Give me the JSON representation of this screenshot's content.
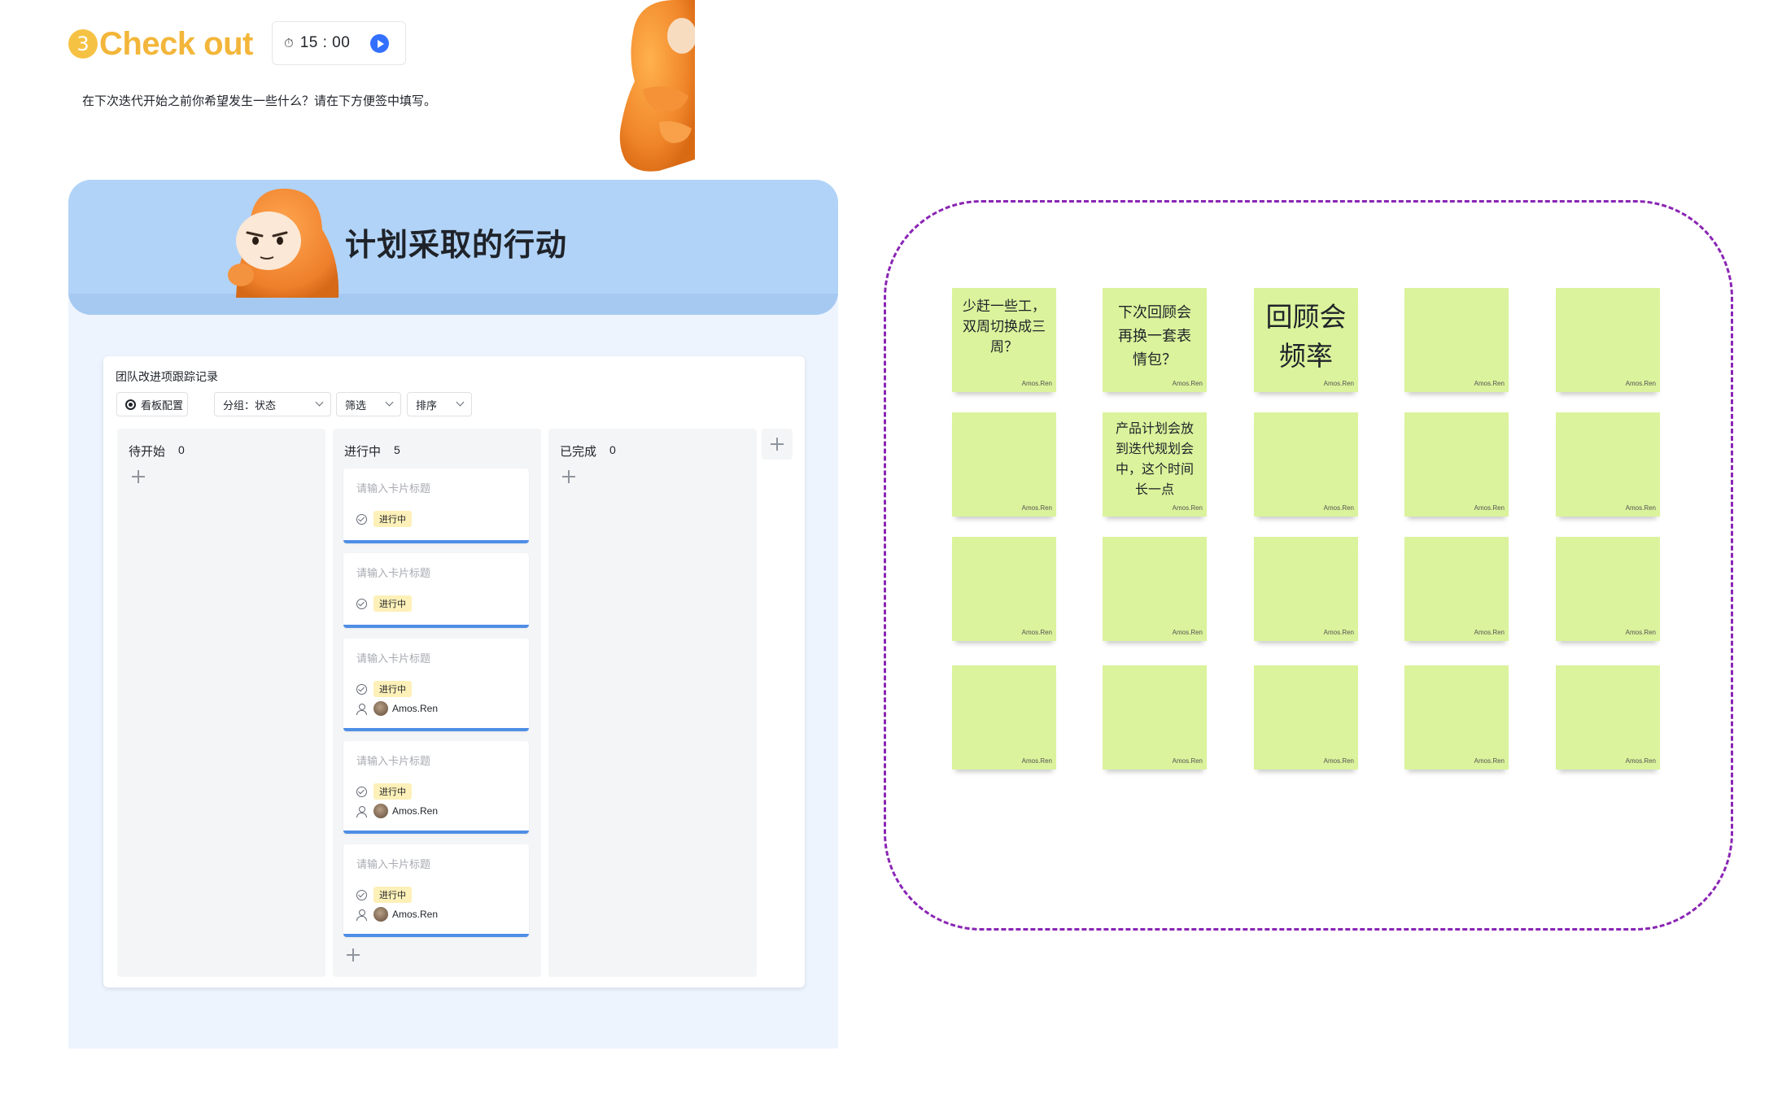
{
  "header": {
    "step_number": "3",
    "title": "Check out",
    "timer": "15 : 00",
    "instruction": "在下次迭代开始之前你希望发生一些什么？请在下方便签中填写。"
  },
  "banner": {
    "title": "计划采取的行动"
  },
  "board": {
    "title": "团队改进项跟踪记录",
    "toolbar": {
      "config": "看板配置",
      "group": "分组：状态",
      "filter": "筛选",
      "sort": "排序"
    },
    "columns": [
      {
        "name": "待开始",
        "count": "0"
      },
      {
        "name": "进行中",
        "count": "5"
      },
      {
        "name": "已完成",
        "count": "0"
      }
    ],
    "cards": [
      {
        "title": "请输入卡片标题",
        "status": "进行中",
        "assignee": ""
      },
      {
        "title": "请输入卡片标题",
        "status": "进行中",
        "assignee": ""
      },
      {
        "title": "请输入卡片标题",
        "status": "进行中",
        "assignee": "Amos.Ren"
      },
      {
        "title": "请输入卡片标题",
        "status": "进行中",
        "assignee": "Amos.Ren"
      },
      {
        "title": "请输入卡片标题",
        "status": "进行中",
        "assignee": "Amos.Ren"
      }
    ]
  },
  "stickies": [
    {
      "text": "少赶一些工，双周切换成三周？",
      "author": "Amos.Ren"
    },
    {
      "text": "下次回顾会再换一套表情包？",
      "author": "Amos.Ren"
    },
    {
      "text": "回顾会频率",
      "author": "Amos.Ren"
    },
    {
      "text": "",
      "author": "Amos.Ren"
    },
    {
      "text": "",
      "author": "Amos.Ren"
    },
    {
      "text": "",
      "author": "Amos.Ren"
    },
    {
      "text": "产品计划会放到迭代规划会中，这个时间长一点",
      "author": "Amos.Ren"
    },
    {
      "text": "",
      "author": "Amos.Ren"
    },
    {
      "text": "",
      "author": "Amos.Ren"
    },
    {
      "text": "",
      "author": "Amos.Ren"
    },
    {
      "text": "",
      "author": "Amos.Ren"
    },
    {
      "text": "",
      "author": "Amos.Ren"
    },
    {
      "text": "",
      "author": "Amos.Ren"
    },
    {
      "text": "",
      "author": "Amos.Ren"
    },
    {
      "text": "",
      "author": "Amos.Ren"
    },
    {
      "text": "",
      "author": "Amos.Ren"
    },
    {
      "text": "",
      "author": "Amos.Ren"
    },
    {
      "text": "",
      "author": "Amos.Ren"
    },
    {
      "text": "",
      "author": "Amos.Ren"
    },
    {
      "text": "",
      "author": "Amos.Ren"
    }
  ],
  "colors": {
    "title": "#f3b63a",
    "banner": "#b1d3f7",
    "panel": "#edf4fe",
    "sticky": "#dbf39c",
    "dash": "#8a25b4",
    "accent": "#3370ff"
  }
}
